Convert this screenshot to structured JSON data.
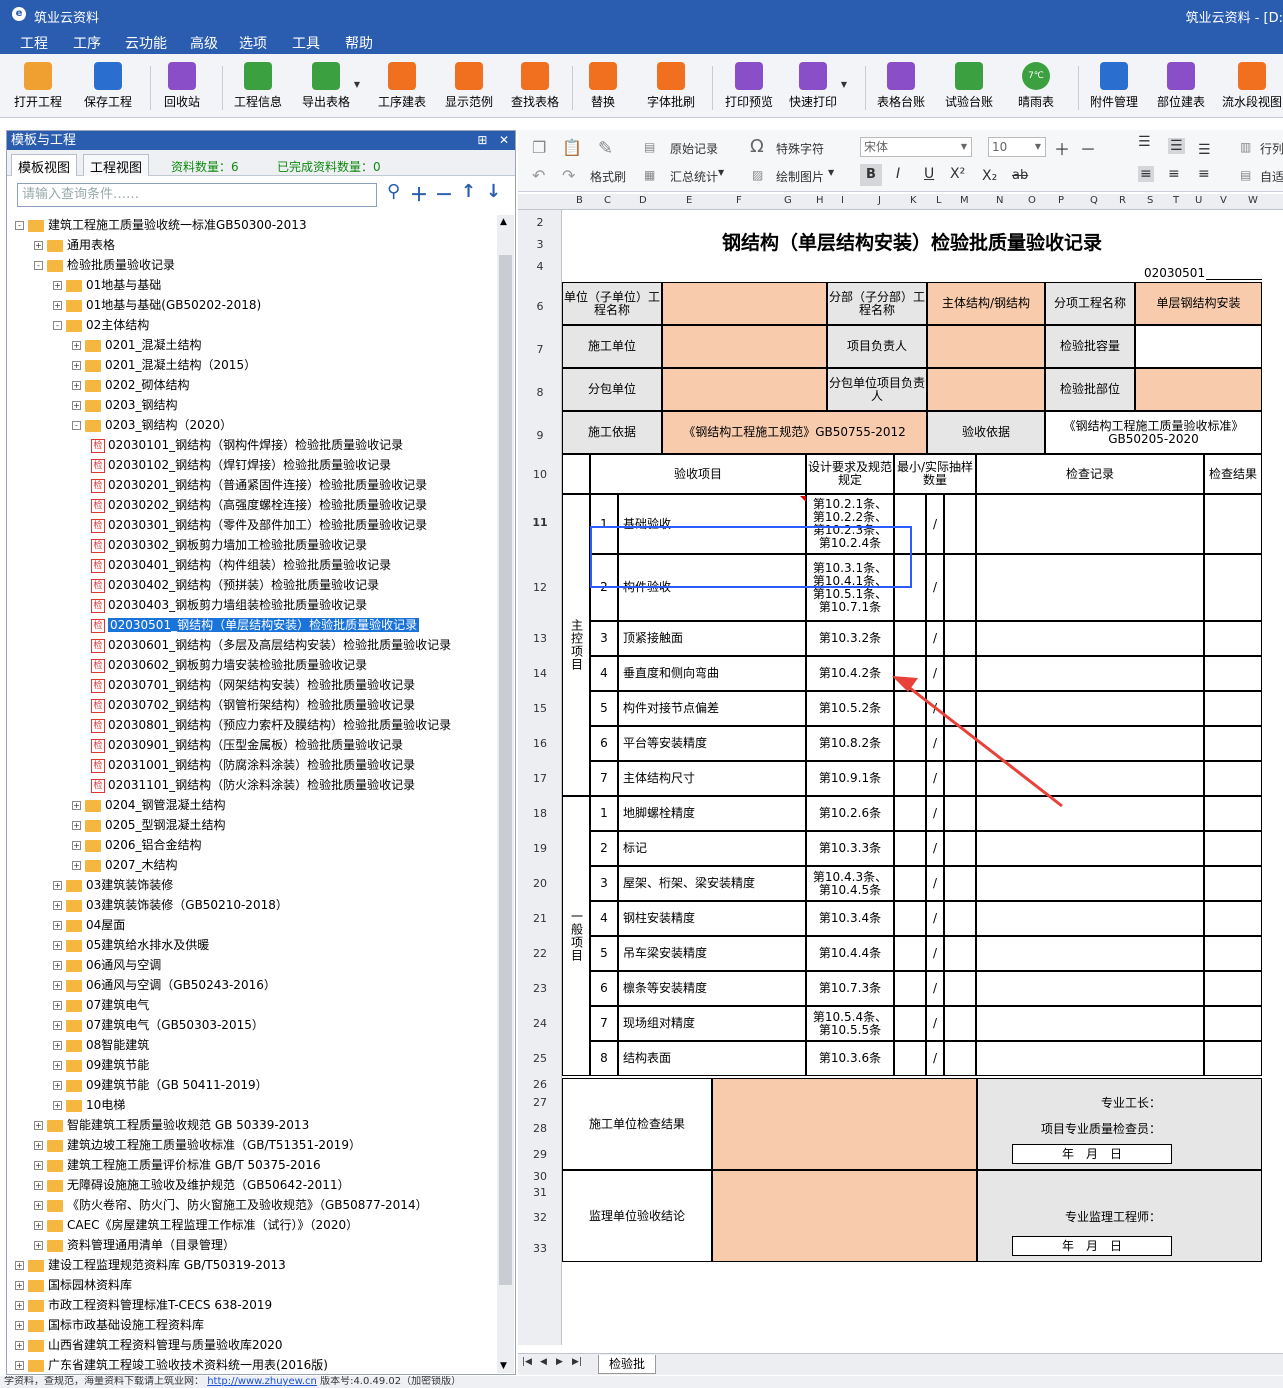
{
  "app": {
    "title": "筑业云资料",
    "title_right": "筑业云资料 - [D:"
  },
  "menu": [
    "工程",
    "工序",
    "云功能",
    "高级",
    "选项",
    "工具",
    "帮助"
  ],
  "toolbar": [
    {
      "label": "打开工程",
      "icon": "folder-open-icon",
      "color": "#f0a030"
    },
    {
      "label": "保存工程",
      "icon": "save-icon",
      "color": "#2a6fcf"
    },
    {
      "label": "回收站",
      "icon": "trash-icon",
      "color": "#8a4fc8"
    },
    {
      "label": "工程信息",
      "icon": "info-icon",
      "color": "#3aa040"
    },
    {
      "label": "导出表格",
      "icon": "export-icon",
      "color": "#3aa040"
    },
    {
      "label": "工序建表",
      "icon": "layers-icon",
      "color": "#f07020"
    },
    {
      "label": "显示范例",
      "icon": "example-icon",
      "color": "#f07020"
    },
    {
      "label": "查找表格",
      "icon": "search-table-icon",
      "color": "#f07020"
    },
    {
      "label": "替换",
      "icon": "replace-icon",
      "color": "#f07020"
    },
    {
      "label": "字体批刷",
      "icon": "font-brush-icon",
      "color": "#f07020"
    },
    {
      "label": "打印预览",
      "icon": "print-preview-icon",
      "color": "#8a4fc8"
    },
    {
      "label": "快速打印",
      "icon": "printer-icon",
      "color": "#8a4fc8"
    },
    {
      "label": "表格台账",
      "icon": "ledger-icon",
      "color": "#8a4fc8"
    },
    {
      "label": "试验台账",
      "icon": "test-ledger-icon",
      "color": "#3aa040"
    },
    {
      "label": "晴雨表",
      "icon": "weather-icon",
      "color": "#3aa040",
      "badge": "7℃"
    },
    {
      "label": "附件管理",
      "icon": "attachment-icon",
      "color": "#2a6fcf"
    },
    {
      "label": "部位建表",
      "icon": "grid-icon",
      "color": "#8a4fc8"
    },
    {
      "label": "流水段视图",
      "icon": "flow-icon",
      "color": "#f07020"
    }
  ],
  "left_panel": {
    "title": "模板与工程",
    "tabs": [
      "模板视图",
      "工程视图"
    ],
    "count_label": "资料数量：6",
    "done_label": "已完成资料数量：0",
    "search_placeholder": "请输入查询条件……",
    "tree": [
      {
        "level": 0,
        "type": "folder",
        "toggle": "-",
        "label": "建筑工程施工质量验收统一标准GB50300-2013"
      },
      {
        "level": 1,
        "type": "folder",
        "toggle": "+",
        "label": "通用表格"
      },
      {
        "level": 1,
        "type": "folder",
        "toggle": "-",
        "label": "检验批质量验收记录"
      },
      {
        "level": 2,
        "type": "folder",
        "toggle": "+",
        "label": "01地基与基础"
      },
      {
        "level": 2,
        "type": "folder",
        "toggle": "+",
        "label": "01地基与基础(GB50202-2018)"
      },
      {
        "level": 2,
        "type": "folder",
        "toggle": "-",
        "label": "02主体结构"
      },
      {
        "level": 3,
        "type": "folder",
        "toggle": "+",
        "label": "0201_混凝土结构"
      },
      {
        "level": 3,
        "type": "folder",
        "toggle": "+",
        "label": "0201_混凝土结构（2015）"
      },
      {
        "level": 3,
        "type": "folder",
        "toggle": "+",
        "label": "0202_砌体结构"
      },
      {
        "level": 3,
        "type": "folder",
        "toggle": "+",
        "label": "0203_钢结构"
      },
      {
        "level": 3,
        "type": "folder",
        "toggle": "-",
        "label": "0203_钢结构（2020）"
      },
      {
        "level": 4,
        "type": "doc",
        "label": "02030101_钢结构（钢构件焊接）检验批质量验收记录"
      },
      {
        "level": 4,
        "type": "doc",
        "label": "02030102_钢结构（焊钉焊接）检验批质量验收记录"
      },
      {
        "level": 4,
        "type": "doc",
        "label": "02030201_钢结构（普通紧固件连接）检验批质量验收记录"
      },
      {
        "level": 4,
        "type": "doc",
        "label": "02030202_钢结构（高强度螺栓连接）检验批质量验收记录"
      },
      {
        "level": 4,
        "type": "doc",
        "label": "02030301_钢结构（零件及部件加工）检验批质量验收记录"
      },
      {
        "level": 4,
        "type": "doc",
        "label": "02030302_钢板剪力墙加工检验批质量验收记录"
      },
      {
        "level": 4,
        "type": "doc",
        "label": "02030401_钢结构（构件组装）检验批质量验收记录"
      },
      {
        "level": 4,
        "type": "doc",
        "label": "02030402_钢结构（预拼装）检验批质量验收记录"
      },
      {
        "level": 4,
        "type": "doc",
        "label": "02030403_钢板剪力墙组装检验批质量验收记录"
      },
      {
        "level": 4,
        "type": "doc",
        "label": "02030501_钢结构（单层结构安装）检验批质量验收记录",
        "selected": true
      },
      {
        "level": 4,
        "type": "doc",
        "label": "02030601_钢结构（多层及高层结构安装）检验批质量验收记录"
      },
      {
        "level": 4,
        "type": "doc",
        "label": "02030602_钢板剪力墙安装检验批质量验收记录"
      },
      {
        "level": 4,
        "type": "doc",
        "label": "02030701_钢结构（网架结构安装）检验批质量验收记录"
      },
      {
        "level": 4,
        "type": "doc",
        "label": "02030702_钢结构（钢管桁架结构）检验批质量验收记录"
      },
      {
        "level": 4,
        "type": "doc",
        "label": "02030801_钢结构（预应力索杆及膜结构）检验批质量验收记录"
      },
      {
        "level": 4,
        "type": "doc",
        "label": "02030901_钢结构（压型金属板）检验批质量验收记录"
      },
      {
        "level": 4,
        "type": "doc",
        "label": "02031001_钢结构（防腐涂料涂装）检验批质量验收记录"
      },
      {
        "level": 4,
        "type": "doc",
        "label": "02031101_钢结构（防火涂料涂装）检验批质量验收记录"
      },
      {
        "level": 3,
        "type": "folder",
        "toggle": "+",
        "label": "0204_钢管混凝土结构"
      },
      {
        "level": 3,
        "type": "folder",
        "toggle": "+",
        "label": "0205_型钢混凝土结构"
      },
      {
        "level": 3,
        "type": "folder",
        "toggle": "+",
        "label": "0206_铝合金结构"
      },
      {
        "level": 3,
        "type": "folder",
        "toggle": "+",
        "label": "0207_木结构"
      },
      {
        "level": 2,
        "type": "folder",
        "toggle": "+",
        "label": "03建筑装饰装修"
      },
      {
        "level": 2,
        "type": "folder",
        "toggle": "+",
        "label": "03建筑装饰装修（GB50210-2018）"
      },
      {
        "level": 2,
        "type": "folder",
        "toggle": "+",
        "label": "04屋面"
      },
      {
        "level": 2,
        "type": "folder",
        "toggle": "+",
        "label": "05建筑给水排水及供暖"
      },
      {
        "level": 2,
        "type": "folder",
        "toggle": "+",
        "label": "06通风与空调"
      },
      {
        "level": 2,
        "type": "folder",
        "toggle": "+",
        "label": "06通风与空调（GB50243-2016）"
      },
      {
        "level": 2,
        "type": "folder",
        "toggle": "+",
        "label": "07建筑电气"
      },
      {
        "level": 2,
        "type": "folder",
        "toggle": "+",
        "label": "07建筑电气（GB50303-2015）"
      },
      {
        "level": 2,
        "type": "folder",
        "toggle": "+",
        "label": "08智能建筑"
      },
      {
        "level": 2,
        "type": "folder",
        "toggle": "+",
        "label": "09建筑节能"
      },
      {
        "level": 2,
        "type": "folder",
        "toggle": "+",
        "label": "09建筑节能（GB 50411-2019）"
      },
      {
        "level": 2,
        "type": "folder",
        "toggle": "+",
        "label": "10电梯"
      },
      {
        "level": 1,
        "type": "folder",
        "toggle": "+",
        "label": "智能建筑工程质量验收规范 GB 50339-2013"
      },
      {
        "level": 1,
        "type": "folder",
        "toggle": "+",
        "label": "建筑边坡工程施工质量验收标准（GB/T51351-2019）"
      },
      {
        "level": 1,
        "type": "folder",
        "toggle": "+",
        "label": "建筑工程施工质量评价标准 GB/T 50375-2016"
      },
      {
        "level": 1,
        "type": "folder",
        "toggle": "+",
        "label": "无障碍设施施工验收及维护规范（GB50642-2011）"
      },
      {
        "level": 1,
        "type": "folder",
        "toggle": "+",
        "label": "《防火卷帘、防火门、防火窗施工及验收规范》（GB50877-2014）"
      },
      {
        "level": 1,
        "type": "folder",
        "toggle": "+",
        "label": "CAEC《房屋建筑工程监理工作标准（试行）》（2020）"
      },
      {
        "level": 1,
        "type": "folder",
        "toggle": "+",
        "label": "资料管理通用清单（目录管理）"
      },
      {
        "level": 0,
        "type": "folder",
        "toggle": "+",
        "label": "建设工程监理规范资料库 GB/T50319-2013"
      },
      {
        "level": 0,
        "type": "folder",
        "toggle": "+",
        "label": "国标园林资料库"
      },
      {
        "level": 0,
        "type": "folder",
        "toggle": "+",
        "label": "市政工程资料管理标准T-CECS 638-2019"
      },
      {
        "level": 0,
        "type": "folder",
        "toggle": "+",
        "label": "国标市政基础设施工程资料库"
      },
      {
        "level": 0,
        "type": "folder",
        "toggle": "+",
        "label": "山西省建筑工程资料管理与质量验收库2020"
      },
      {
        "level": 0,
        "type": "folder",
        "toggle": "+",
        "label": "广东省建筑工程竣工验收技术资料统一用表(2016版)"
      }
    ]
  },
  "editor_toolbar": {
    "original_record": "原始记录",
    "format_brush": "格式刷",
    "summary": "汇总统计",
    "special_char": "特殊字符",
    "draw_image": "绘制图片",
    "font_name": "宋体",
    "font_size": "10",
    "bold": "B",
    "italic": "I",
    "underline": "U",
    "superscript": "X²",
    "subscript": "X₂",
    "strike": "ab",
    "row_label": "行列",
    "auto_label": "自适"
  },
  "columns": [
    "B",
    "C",
    "D",
    "E",
    "F",
    "G",
    "H",
    "I",
    "J",
    "K",
    "L",
    "M",
    "N",
    "O",
    "P",
    "Q",
    "R",
    "S",
    "T",
    "U",
    "V",
    "W"
  ],
  "rows": [
    "2",
    "3",
    "4",
    "6",
    "7",
    "8",
    "9",
    "10",
    "11",
    "12",
    "13",
    "14",
    "15",
    "16",
    "17",
    "18",
    "19",
    "20",
    "21",
    "22",
    "23",
    "24",
    "25",
    "26",
    "27",
    "28",
    "29",
    "30",
    "31",
    "32",
    "33"
  ],
  "form": {
    "title": "钢结构（单层结构安装）检验批质量验收记录",
    "code": "02030501",
    "unit_label": "单位（子单位）工程名称",
    "division_label": "分部（子分部）工程名称",
    "division_value": "主体结构/钢结构",
    "subitem_label": "分项工程名称",
    "subitem_value": "单层钢结构安装",
    "constructor_label": "施工单位",
    "pm_label": "项目负责人",
    "capacity_label": "检验批容量",
    "subcontractor_label": "分包单位",
    "sub_pm_label": "分包单位项目负责人",
    "part_label": "检验批部位",
    "basis_label": "施工依据",
    "basis_value": "《钢结构工程施工规范》GB50755-2012",
    "accept_basis_label": "验收依据",
    "accept_basis_value": "《钢结构工程施工质量验收标准》GB50205-2020",
    "head_item": "验收项目",
    "head_req": "设计要求及规范规定",
    "head_min": "最小/实际抽样数量",
    "head_record": "检查记录",
    "head_result": "检查结果",
    "main_group": "主控项目",
    "general_group": "一般项目",
    "main_items": [
      {
        "no": "1",
        "name": "基础验收",
        "req": "第10.2.1条、第10.2.2条、第10.2.3条、第10.2.4条",
        "min": "/"
      },
      {
        "no": "2",
        "name": "构件验收",
        "req": "第10.3.1条、第10.4.1条、第10.5.1条、第10.7.1条",
        "min": "/"
      },
      {
        "no": "3",
        "name": "顶紧接触面",
        "req": "第10.3.2条",
        "min": "/"
      },
      {
        "no": "4",
        "name": "垂直度和侧向弯曲",
        "req": "第10.4.2条",
        "min": "/"
      },
      {
        "no": "5",
        "name": "构件对接节点偏差",
        "req": "第10.5.2条",
        "min": "/"
      },
      {
        "no": "6",
        "name": "平台等安装精度",
        "req": "第10.8.2条",
        "min": "/"
      },
      {
        "no": "7",
        "name": "主体结构尺寸",
        "req": "第10.9.1条",
        "min": "/"
      }
    ],
    "general_items": [
      {
        "no": "1",
        "name": "地脚螺栓精度",
        "req": "第10.2.6条",
        "min": "/"
      },
      {
        "no": "2",
        "name": "标记",
        "req": "第10.3.3条",
        "min": "/"
      },
      {
        "no": "3",
        "name": "屋架、桁架、梁安装精度",
        "req": "第10.4.3条、第10.4.5条",
        "min": "/"
      },
      {
        "no": "4",
        "name": "钢柱安装精度",
        "req": "第10.3.4条",
        "min": "/"
      },
      {
        "no": "5",
        "name": "吊车梁安装精度",
        "req": "第10.4.4条",
        "min": "/"
      },
      {
        "no": "6",
        "name": "檩条等安装精度",
        "req": "第10.7.3条",
        "min": "/"
      },
      {
        "no": "7",
        "name": "现场组对精度",
        "req": "第10.5.4条、第10.5.5条",
        "min": "/"
      },
      {
        "no": "8",
        "name": "结构表面",
        "req": "第10.3.6条",
        "min": "/"
      }
    ],
    "constructor_check_label": "施工单位检查结果",
    "foreman_label": "专业工长：",
    "qc_label": "项目专业质量检查员：",
    "date_label": "年　月　日",
    "supervisor_label": "监理单位验收结论",
    "engineer_label": "专业监理工程师：",
    "date_label2": "年　月　日"
  },
  "sheet_tab": "检验批",
  "status": {
    "prefix": "学资料，查规范，海量资料下载请上筑业网：",
    "link": "http://www.zhuyew.cn",
    "version": "版本号:4.0.49.02（加密锁版）"
  },
  "colors": {
    "titlebar": "#2a5db0",
    "peach": "#f8cbad",
    "selection": "#1a73d9",
    "arrow": "#e8413a"
  }
}
